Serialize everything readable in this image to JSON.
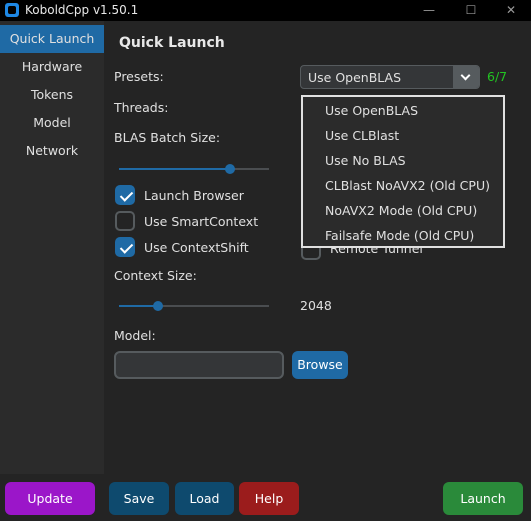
{
  "window": {
    "title": "KoboldCpp v1.50.1"
  },
  "sidebar": {
    "items": [
      {
        "label": "Quick Launch"
      },
      {
        "label": "Hardware"
      },
      {
        "label": "Tokens"
      },
      {
        "label": "Model"
      },
      {
        "label": "Network"
      }
    ]
  },
  "main": {
    "title": "Quick Launch",
    "presets_label": "Presets:",
    "preset_value": "Use OpenBLAS",
    "preset_count": "6/7",
    "preset_options": [
      "Use OpenBLAS",
      "Use CLBlast",
      "Use No BLAS",
      "CLBlast NoAVX2 (Old CPU)",
      "NoAVX2 Mode (Old CPU)",
      "Failsafe Mode (Old CPU)"
    ],
    "threads_label": "Threads:",
    "blas_label": "BLAS Batch Size:",
    "blas_slider_fraction": 0.74,
    "launch_browser_label": "Launch Browser",
    "launch_browser_checked": true,
    "smartcontext_label": "Use SmartContext",
    "smartcontext_checked": false,
    "contextshift_label": "Use ContextShift",
    "contextshift_checked": true,
    "remote_tunnel_label": "Remote Tunnel",
    "remote_tunnel_checked": false,
    "context_label": "Context Size:",
    "context_value": "2048",
    "context_slider_fraction": 0.26,
    "model_label": "Model:",
    "model_value": "",
    "browse_label": "Browse"
  },
  "footer": {
    "update_label": "Update",
    "save_label": "Save",
    "load_label": "Load",
    "help_label": "Help",
    "launch_label": "Launch"
  },
  "colors": {
    "accent": "#1f6aa5",
    "update": "#9b16c9",
    "save_load": "#0e4a6e",
    "help": "#9b1c1c",
    "launch": "#2a8a3a",
    "count": "#22c322"
  }
}
